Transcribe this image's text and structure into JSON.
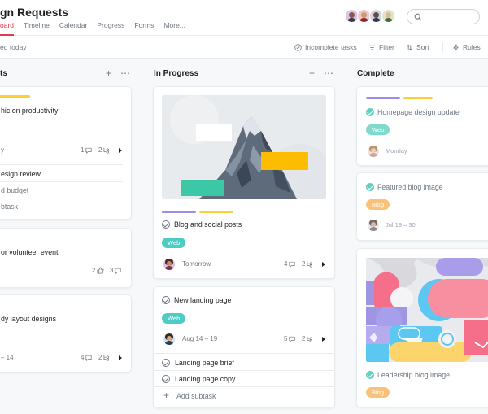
{
  "header": {
    "title": "gn Requests",
    "tabs": [
      "oard",
      "Timeline",
      "Calendar",
      "Progress",
      "Forms",
      "More..."
    ],
    "active_tab": "oard"
  },
  "toolbar": {
    "status": "ed today",
    "incomplete": "Incomplete tasks",
    "filter": "Filter",
    "sort": "Sort",
    "rules": "Rules"
  },
  "columns": {
    "first": {
      "title": "ts",
      "cards": [
        {
          "title": "hic on productivity",
          "date": "y",
          "comments": "1",
          "subtasks": "2"
        },
        {
          "subtask1": "esign review",
          "subtask2": "d budget",
          "add": "btask"
        },
        {
          "title": "or volunteer event",
          "likes": "2",
          "comments": "3"
        },
        {
          "title": "dy layout designs",
          "date": "– 14",
          "comments": "4",
          "subtasks": "2"
        }
      ]
    },
    "second": {
      "title": "In Progress",
      "card1": {
        "title": "Blog and social posts",
        "tag": "Web",
        "date": "Tomorrow",
        "comments": "4",
        "subtasks": "2"
      },
      "card2": {
        "title": "New landing page",
        "tag": "Web",
        "date": "Aug 14 – 19",
        "comments": "5",
        "subtasks": "2",
        "subtask1": "Landing page brief",
        "subtask2": "Landing page copy",
        "add": "Add subtask"
      }
    },
    "third": {
      "title": "Complete",
      "card1": {
        "title": "Homepage design update",
        "tag": "Web",
        "date": "Monday"
      },
      "card2": {
        "title": "Featured blog image",
        "tag": "Blog",
        "date": "Jul 19 – 30"
      },
      "card3": {
        "title": "Leadership blog image",
        "tag": "Blog"
      }
    }
  },
  "colors": {
    "accent": "#e8384f",
    "web_tag": "#4ecbc4",
    "blog_tag": "#f8c27a",
    "yellow": "#fcd034",
    "purple": "#9e8be8",
    "complete_check": "#5fd0c0"
  },
  "icons": [
    "search-icon",
    "check-circle-icon",
    "filter-icon",
    "sort-icon",
    "rules-icon",
    "plus-icon",
    "more-icon",
    "comment-icon",
    "subtask-icon",
    "like-icon",
    "chevron-right-icon"
  ]
}
